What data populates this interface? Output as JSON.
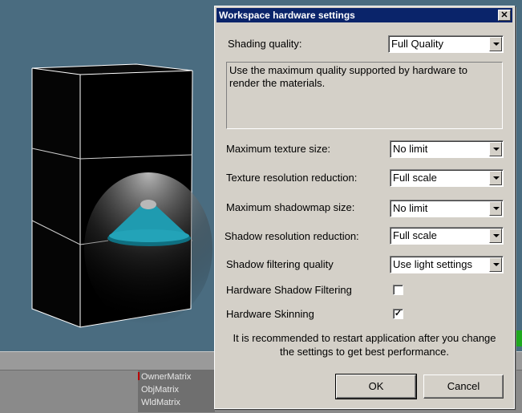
{
  "background": {
    "matrix_list": [
      "OwnerMatrix",
      "ObjMatrix",
      "WldMatrix"
    ]
  },
  "dialog": {
    "title": "Workspace hardware settings",
    "close_glyph": "✕",
    "shading_quality": {
      "label": "Shading quality:",
      "value": "Full Quality"
    },
    "description": "Use the maximum quality supported by hardware to render the materials.",
    "settings": [
      {
        "label": "Maximum texture size:",
        "value": "No limit"
      },
      {
        "label": "Texture resolution reduction:",
        "value": "Full scale"
      },
      {
        "label": "Maximum shadowmap size:",
        "value": "No limit"
      },
      {
        "label": "Shadow resolution reduction:",
        "value": "Full scale"
      },
      {
        "label": "Shadow filtering quality",
        "value": "Use light settings"
      }
    ],
    "checkboxes": [
      {
        "label": "Hardware Shadow Filtering",
        "checked": false
      },
      {
        "label": "Hardware Skinning",
        "checked": true
      }
    ],
    "note": "It is recommended to restart application after you change the settings to get best performance.",
    "ok_label": "OK",
    "cancel_label": "Cancel"
  },
  "colors": {
    "titlebar": "#0a246a",
    "dialog_face": "#d4d0c8",
    "viewport": "#4a6c80",
    "lamp_shade": "#1f9bb0"
  }
}
